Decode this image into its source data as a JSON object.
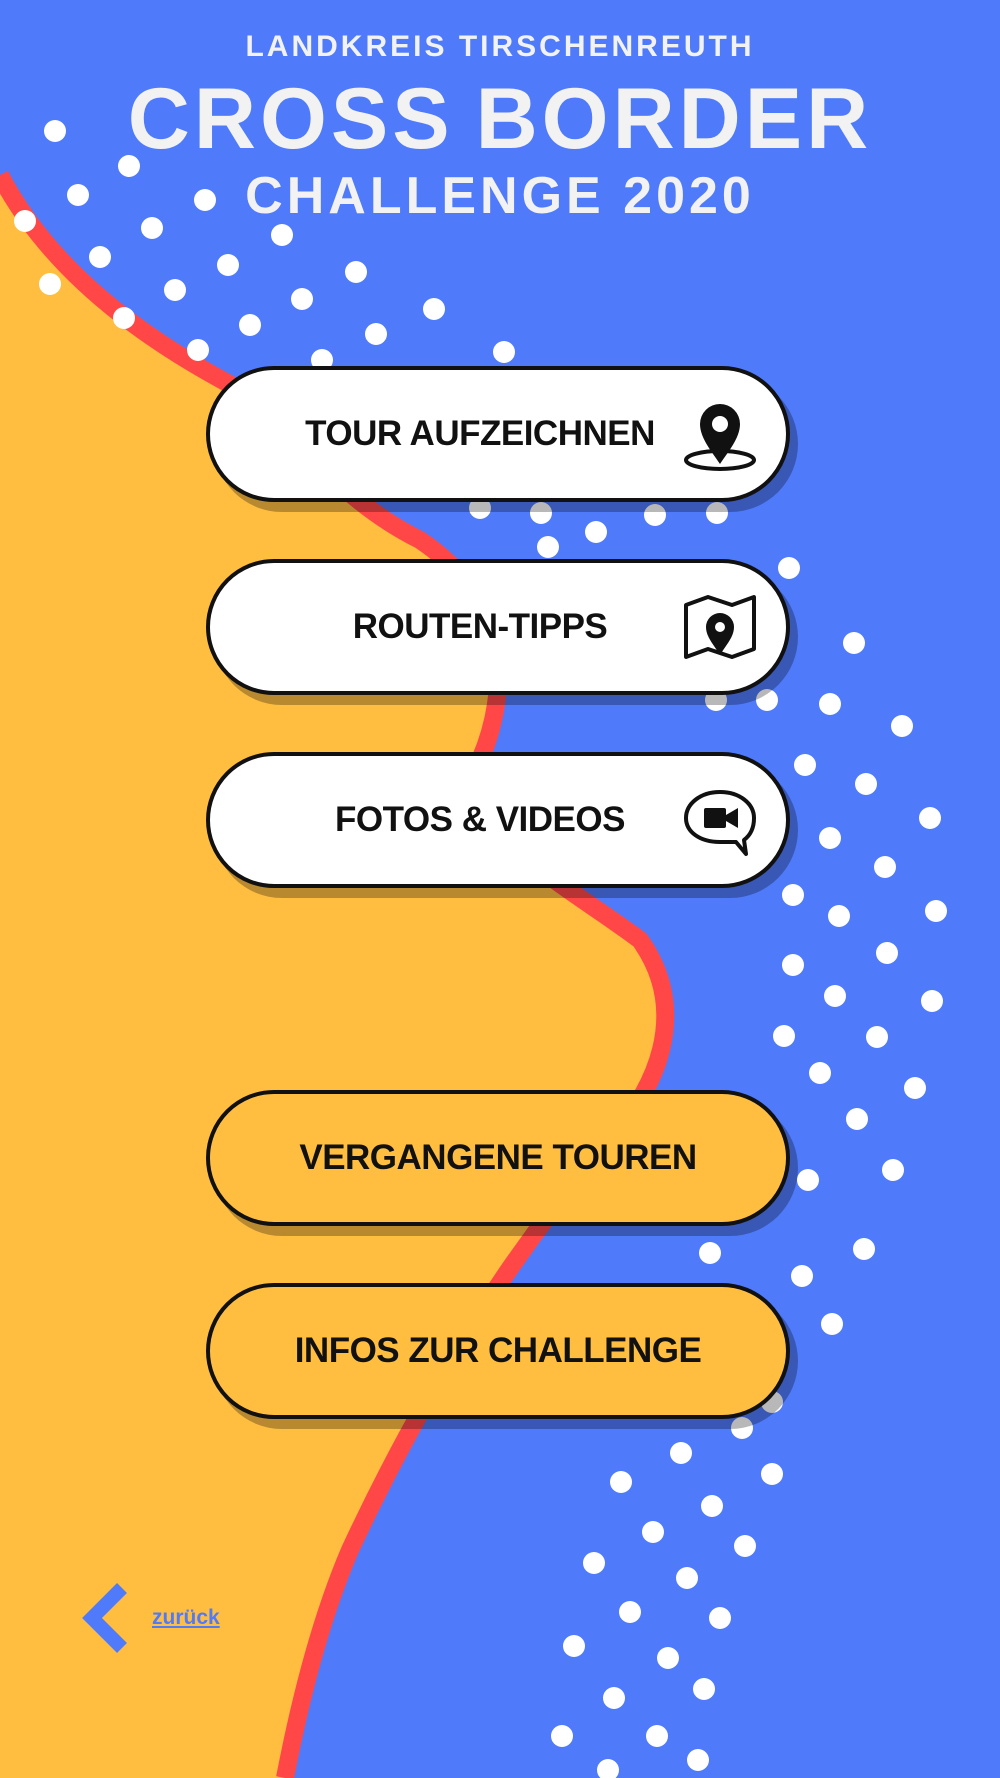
{
  "header": {
    "region": "LANDKREIS TIRSCHENREUTH",
    "brand_word1": "CROSS",
    "brand_word2": "BORDER",
    "event": "CHALLENGE 2020"
  },
  "menu": {
    "record_tour": {
      "label": "TOUR AUFZEICHNEN",
      "icon": "map-pin-icon"
    },
    "route_tips": {
      "label": "ROUTEN-TIPPS",
      "icon": "map-location-icon"
    },
    "photos_videos": {
      "label": "FOTOS & VIDEOS",
      "icon": "video-chat-icon"
    },
    "past_tours": {
      "label": "VERGANGENE TOUREN"
    },
    "challenge_info": {
      "label": "INFOS ZUR CHALLENGE"
    }
  },
  "back": {
    "label": "zurück",
    "icon": "chevron-left-icon"
  },
  "colors": {
    "background_blue": "#4f7bfb",
    "sand_yellow": "#ffbe40",
    "border_red": "#ff4747",
    "button_white": "#ffffff",
    "outline_black": "#111111",
    "dot_white": "#ffffff"
  }
}
